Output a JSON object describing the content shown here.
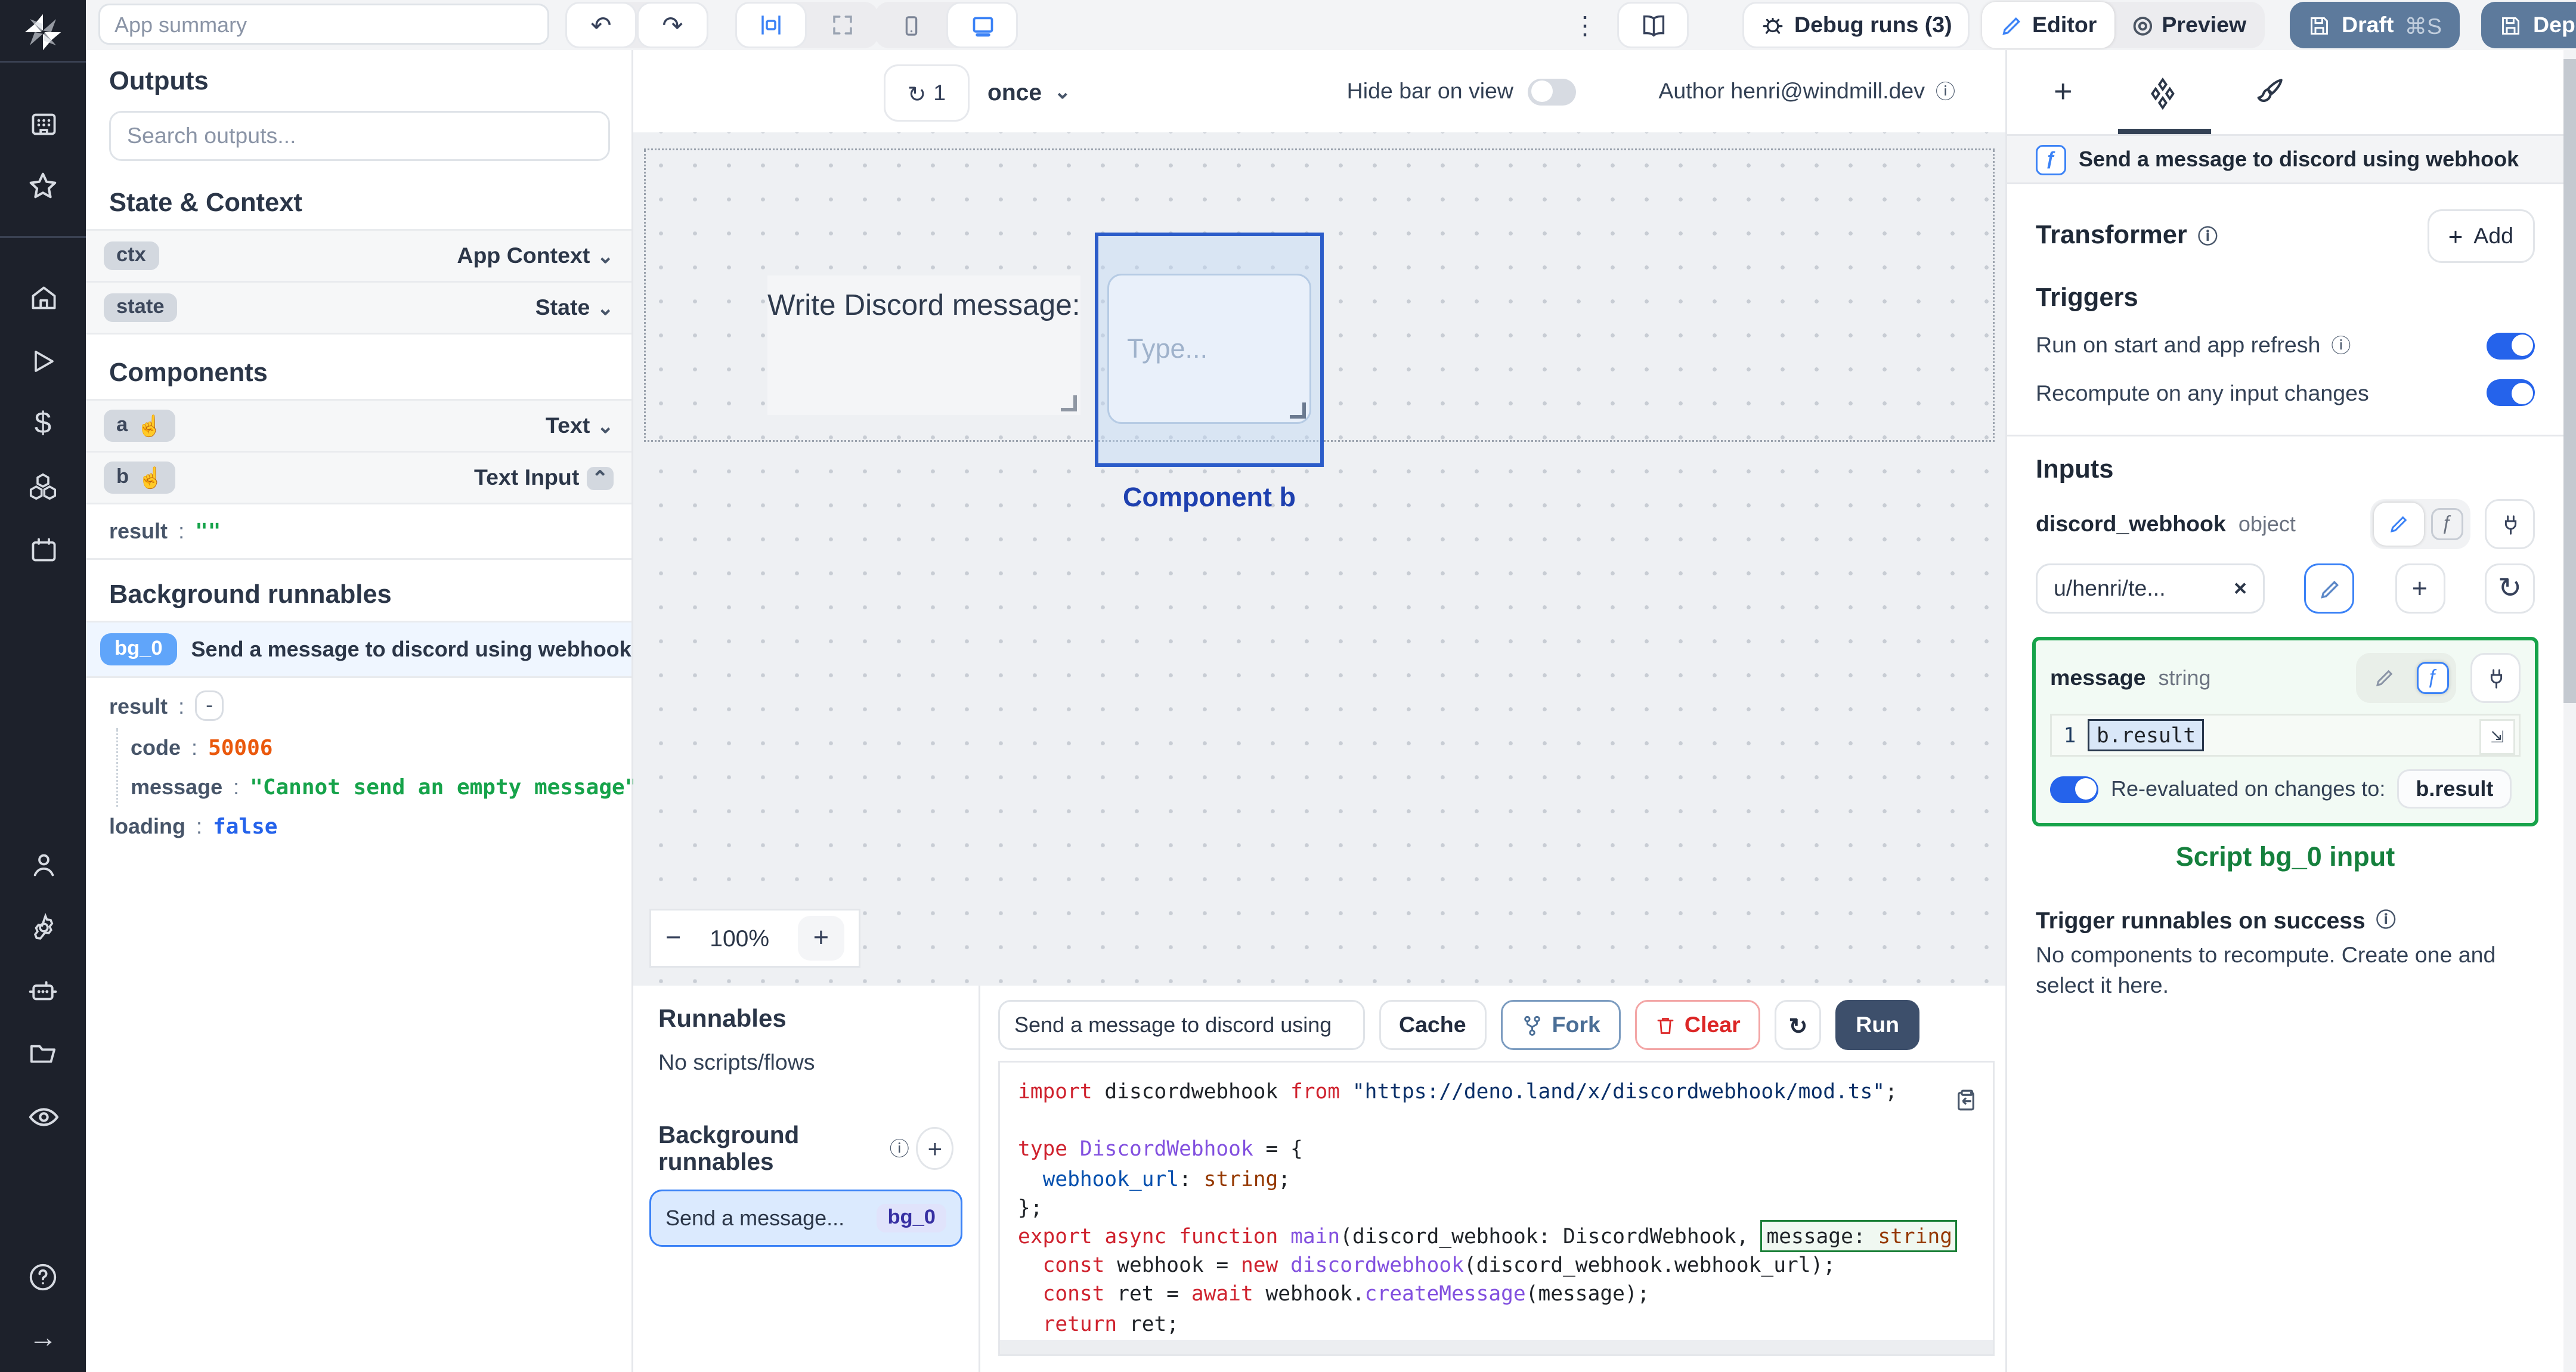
{
  "topbar": {
    "app_summary_placeholder": "App summary",
    "debug_runs": "Debug runs (3)",
    "editor": "Editor",
    "preview": "Preview",
    "draft": "Draft",
    "draft_shortcut": "⌘S",
    "deploy": "Deploy"
  },
  "canvas_toolbar": {
    "refresh_count": "1",
    "schedule": "once",
    "hide_bar_label": "Hide bar on view",
    "author_label": "Author henri@windmill.dev"
  },
  "outputs_panel": {
    "title": "Outputs",
    "search_placeholder": "Search outputs...",
    "state_context_title": "State & Context",
    "ctx_key": "ctx",
    "ctx_label": "App Context",
    "state_key": "state",
    "state_label": "State",
    "components_title": "Components",
    "comp_a_key": "a",
    "comp_a_label": "Text",
    "comp_b_key": "b",
    "comp_b_label": "Text Input",
    "result_key": "result",
    "colon": ":",
    "b_result_value": "\"\"",
    "background_title": "Background runnables",
    "bg0_badge": "bg_0",
    "bg0_title": "Send a message to discord using webhook",
    "bg0_edit_icon": "✎",
    "bg0_result_key": "result",
    "bg0_result_collapse": "-",
    "bg0_code_key": "code",
    "bg0_code_value": "50006",
    "bg0_message_key": "message",
    "bg0_message_value": "\"Cannot send an empty message\"",
    "bg0_loading_key": "loading",
    "bg0_loading_value": "false"
  },
  "canvas": {
    "text_component": "Write Discord message:",
    "input_placeholder": "Type...",
    "selected_component_label": "Component b",
    "zoom_level": "100%",
    "zoom_minus": "−",
    "zoom_plus": "+"
  },
  "runnables_panel": {
    "title": "Runnables",
    "empty_text": "No scripts/flows",
    "background_title": "Background runnables",
    "item_name": "Send a message...",
    "item_badge": "bg_0"
  },
  "code_panel": {
    "name_value": "Send a message to discord using",
    "cache_label": "Cache",
    "fork_label": "Fork",
    "clear_label": "Clear",
    "run_label": "Run",
    "lines": [
      [
        [
          "import",
          "kw"
        ],
        [
          " discordwebhook ",
          "pl"
        ],
        [
          "from",
          "kw"
        ],
        [
          " ",
          "pl"
        ],
        [
          "\"https://deno.land/x/discordwebhook/mod.ts\"",
          "str"
        ],
        [
          ";",
          "pl"
        ]
      ],
      [
        [
          "",
          "pl"
        ]
      ],
      [
        [
          "type",
          "kw"
        ],
        [
          " ",
          "pl"
        ],
        [
          "DiscordWebhook",
          "typ"
        ],
        [
          " = {",
          "pl"
        ]
      ],
      [
        [
          "  ",
          "pl"
        ],
        [
          "webhook_url",
          "prop"
        ],
        [
          ": ",
          "pl"
        ],
        [
          "string",
          "orange"
        ],
        [
          ";",
          "pl"
        ]
      ],
      [
        [
          "};",
          "pl"
        ]
      ],
      [
        [
          "export",
          "kw"
        ],
        [
          " ",
          "pl"
        ],
        [
          "async",
          "kw"
        ],
        [
          " ",
          "pl"
        ],
        [
          "function",
          "kw"
        ],
        [
          " ",
          "pl"
        ],
        [
          "main",
          "typ"
        ],
        [
          "(discord_webhook: DiscordWebhook, ",
          "pl"
        ],
        [
          "message: ",
          "boxpl"
        ],
        [
          "string",
          "boxor"
        ]
      ],
      [
        [
          "  ",
          "pl"
        ],
        [
          "const",
          "kw"
        ],
        [
          " webhook = ",
          "pl"
        ],
        [
          "new",
          "kw"
        ],
        [
          " ",
          "pl"
        ],
        [
          "discordwebhook",
          "typ"
        ],
        [
          "(discord_webhook.webhook_url);",
          "pl"
        ]
      ],
      [
        [
          "  ",
          "pl"
        ],
        [
          "const",
          "kw"
        ],
        [
          " ret = ",
          "pl"
        ],
        [
          "await",
          "kw"
        ],
        [
          " webhook.",
          "pl"
        ],
        [
          "createMessage",
          "typ"
        ],
        [
          "(message);",
          "pl"
        ]
      ],
      [
        [
          "  ",
          "pl"
        ],
        [
          "return",
          "kw"
        ],
        [
          " ret;",
          "pl"
        ]
      ],
      [
        [
          "}",
          "pl"
        ]
      ]
    ]
  },
  "right_panel": {
    "header_title": "Send a message to discord using webhook",
    "fn_icon": "ƒ",
    "transformer_title": "Transformer",
    "add_label": "Add",
    "triggers_title": "Triggers",
    "trigger1": "Run on start and app refresh",
    "trigger2": "Recompute on any input changes",
    "inputs_title": "Inputs",
    "field1_name": "discord_webhook",
    "field1_type": "object",
    "field1_value": "u/henri/te...",
    "field2_name": "message",
    "field2_type": "string",
    "line_number": "1",
    "expr_value": "b.result",
    "reeval_label": "Re-evaluated on changes to:",
    "reeval_target": "b.result",
    "script_label": "Script bg_0 input",
    "success_title": "Trigger runnables on success",
    "success_body": "No components to recompute. Create one and select it here."
  },
  "colors": {
    "accent_blue": "#3b82f6",
    "toggle_on": "#2563eb",
    "slate_button": "#5d7a9c",
    "run_button": "#3d4f6b",
    "green_accent": "#16a34a",
    "bg0_badge_blue": "#60a5fa",
    "sidebar_dark": "#1d212b"
  }
}
